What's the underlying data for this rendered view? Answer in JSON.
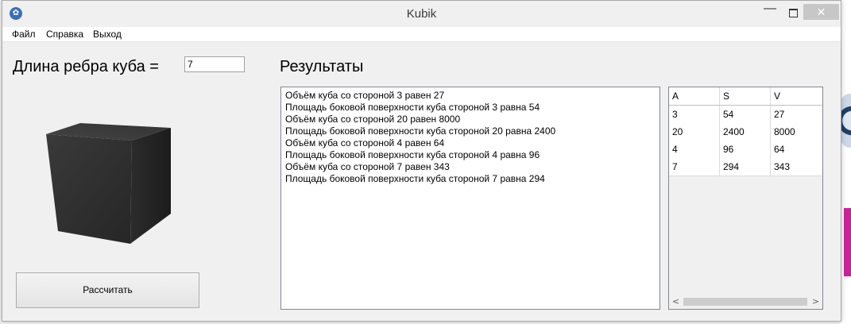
{
  "window": {
    "title": "Kubik"
  },
  "titlebar": {
    "minimize_glyph": "—",
    "close_glyph": "✕"
  },
  "menu": {
    "items": [
      "Файл",
      "Справка",
      "Выход"
    ]
  },
  "input": {
    "label": "Длина ребра куба =",
    "value": "7"
  },
  "results": {
    "title": "Результаты",
    "lines": [
      "Объём куба со стороной 3 равен 27",
      "Площадь боковой поверхности куба стороной 3 равна 54",
      "Объём куба со стороной 20 равен 8000",
      "Площадь боковой поверхности куба стороной 20 равна 2400",
      "Объём куба со стороной 4 равен 64",
      "Площадь боковой поверхности куба стороной 4 равна 96",
      "Объём куба со стороной 7 равен 343",
      "Площадь боковой поверхности куба стороной 7 равна 294"
    ]
  },
  "button": {
    "calculate_label": "Рассчитать"
  },
  "table": {
    "columns": [
      "A",
      "S",
      "V"
    ],
    "rows": [
      [
        "3",
        "54",
        "27"
      ],
      [
        "20",
        "2400",
        "8000"
      ],
      [
        "4",
        "96",
        "64"
      ],
      [
        "7",
        "294",
        "343"
      ]
    ]
  },
  "scrollbar": {
    "left_arrow": "<",
    "right_arrow": ">"
  },
  "colors": {
    "close_button": "#c7c7c7",
    "window_bg": "#f0f0f0",
    "cube_dark": "#2a2a2a"
  }
}
